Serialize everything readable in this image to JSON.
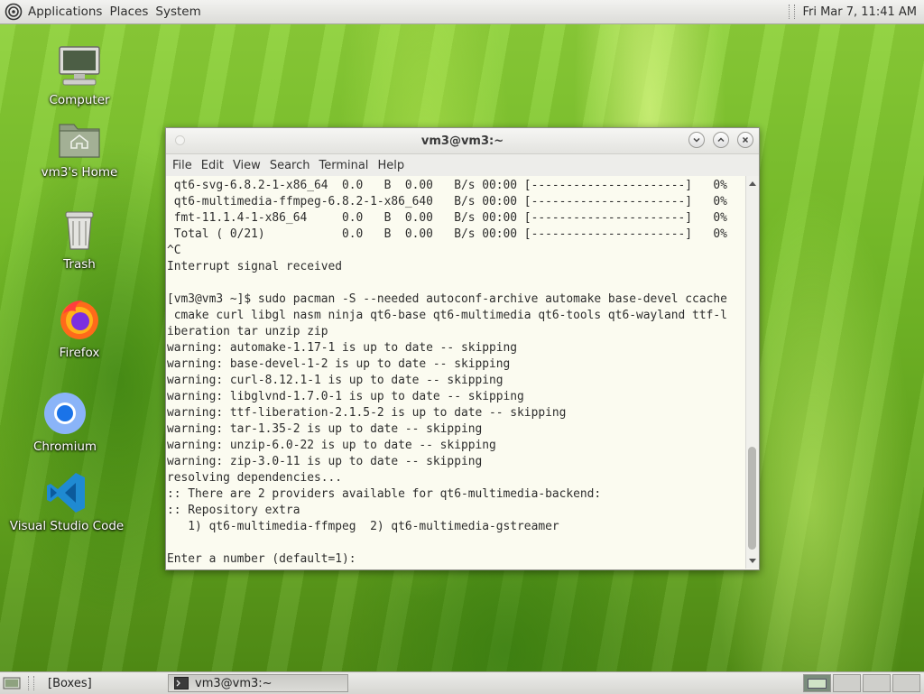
{
  "top_panel": {
    "menus": [
      "Applications",
      "Places",
      "System"
    ],
    "clock": "Fri Mar  7, 11:41 AM"
  },
  "desktop_icons": [
    {
      "label": "Computer",
      "icon": "computer-icon"
    },
    {
      "label": "vm3's Home",
      "icon": "home-folder-icon"
    },
    {
      "label": "Trash",
      "icon": "trash-icon"
    },
    {
      "label": "Firefox",
      "icon": "firefox-icon"
    },
    {
      "label": "Chromium",
      "icon": "chromium-icon"
    },
    {
      "label": "Visual Studio Code",
      "icon": "vscode-icon"
    }
  ],
  "terminal": {
    "title": "vm3@vm3:~",
    "menu": [
      "File",
      "Edit",
      "View",
      "Search",
      "Terminal",
      "Help"
    ],
    "lines": [
      " qt6-svg-6.8.2-1-x86_64  0.0   B  0.00   B/s 00:00 [----------------------]   0%",
      " qt6-multimedia-ffmpeg-6.8.2-1-x86_640   B/s 00:00 [----------------------]   0%",
      " fmt-11.1.4-1-x86_64     0.0   B  0.00   B/s 00:00 [----------------------]   0%",
      " Total ( 0/21)           0.0   B  0.00   B/s 00:00 [----------------------]   0%",
      "^C",
      "Interrupt signal received",
      "",
      "[vm3@vm3 ~]$ sudo pacman -S --needed autoconf-archive automake base-devel ccache",
      " cmake curl libgl nasm ninja qt6-base qt6-multimedia qt6-tools qt6-wayland ttf-l",
      "iberation tar unzip zip",
      "warning: automake-1.17-1 is up to date -- skipping",
      "warning: base-devel-1-2 is up to date -- skipping",
      "warning: curl-8.12.1-1 is up to date -- skipping",
      "warning: libglvnd-1.7.0-1 is up to date -- skipping",
      "warning: ttf-liberation-2.1.5-2 is up to date -- skipping",
      "warning: tar-1.35-2 is up to date -- skipping",
      "warning: unzip-6.0-22 is up to date -- skipping",
      "warning: zip-3.0-11 is up to date -- skipping",
      "resolving dependencies...",
      ":: There are 2 providers available for qt6-multimedia-backend:",
      ":: Repository extra",
      "   1) qt6-multimedia-ffmpeg  2) qt6-multimedia-gstreamer",
      "",
      "Enter a number (default=1):"
    ]
  },
  "taskbar": {
    "items": [
      {
        "label": "[Boxes]",
        "icon": "boxes-window-icon",
        "active": false
      },
      {
        "label": "vm3@vm3:~",
        "icon": "terminal-icon",
        "active": true
      }
    ]
  },
  "colors": {
    "terminal_bg": "#fbfbf0",
    "terminal_fg": "#2d2d2d",
    "desktop_green": "#79c12a"
  }
}
